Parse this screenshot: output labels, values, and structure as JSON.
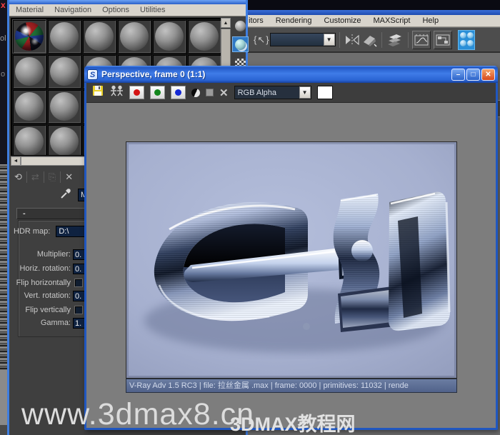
{
  "desktop_fragments": {
    "close_x": "x",
    "text_ol": "ol",
    "text_o": "o"
  },
  "main_window": {
    "menu_items": [
      "itors",
      "Rendering",
      "Customize",
      "MAXScript",
      "Help"
    ],
    "toolbar": {
      "named_selection_icon": "{↖}",
      "selection_dropdown_value": "",
      "dropdown_arrow": "▼",
      "icons": [
        "mirror",
        "align",
        "layer-manager",
        "curve-editor",
        "schematic-view",
        "material-editor"
      ]
    },
    "render_scene_glyph": "▣"
  },
  "material_editor": {
    "menu_items": [
      "Material",
      "Navigation",
      "Options",
      "Utilities"
    ],
    "slots": {
      "rows": 4,
      "cols": 6,
      "active_slot": 0
    },
    "scroll": {
      "up_arrow": "▲",
      "left_arrow": "◄"
    },
    "toolbar": {
      "get_material": "⟲",
      "put_material": "⇄",
      "assign_material": "⎘",
      "reset_map": "✕"
    },
    "name_field_value": "M",
    "rollout": {
      "header": "-",
      "hdr_map_label": "HDR map:",
      "hdr_map_value": "D:\\",
      "params": [
        {
          "label": "Multiplier:",
          "value": "0.",
          "type": "field"
        },
        {
          "label": "Horiz. rotation:",
          "value": "0.",
          "type": "field"
        },
        {
          "label": "Flip horizontally",
          "value": "",
          "type": "checkbox"
        },
        {
          "label": "Vert. rotation:",
          "value": "0.",
          "type": "field"
        },
        {
          "label": "Flip vertically",
          "value": "",
          "type": "checkbox"
        },
        {
          "label": "Gamma:",
          "value": "1.",
          "type": "field"
        }
      ]
    }
  },
  "render_window": {
    "title": "Perspective, frame 0 (1:1)",
    "window_icon_glyph": "S",
    "buttons": {
      "minimize": "–",
      "maximize": "□",
      "close": "✕"
    },
    "channel_dropdown": "RGB Alpha",
    "dropdown_arrow": "▼",
    "clear_label": "✕",
    "status_text": "V-Ray Adv 1.5 RC3 | file: 拉丝金属 .max | frame: 0000 | primitives: 11032 | rende"
  },
  "watermark": {
    "url": "www.3dmax8.cn",
    "site_name": "3DMAX教程网"
  },
  "colors": {
    "xp_title_blue": "#2157c4",
    "render_background": "#a9b3d1",
    "status_bar": "#56688c",
    "field_navy": "#0f2240",
    "highlight_blue": "#2a8fd8",
    "menu_gray": "#d8d4cc",
    "panel_gray": "#3f3f3f"
  }
}
